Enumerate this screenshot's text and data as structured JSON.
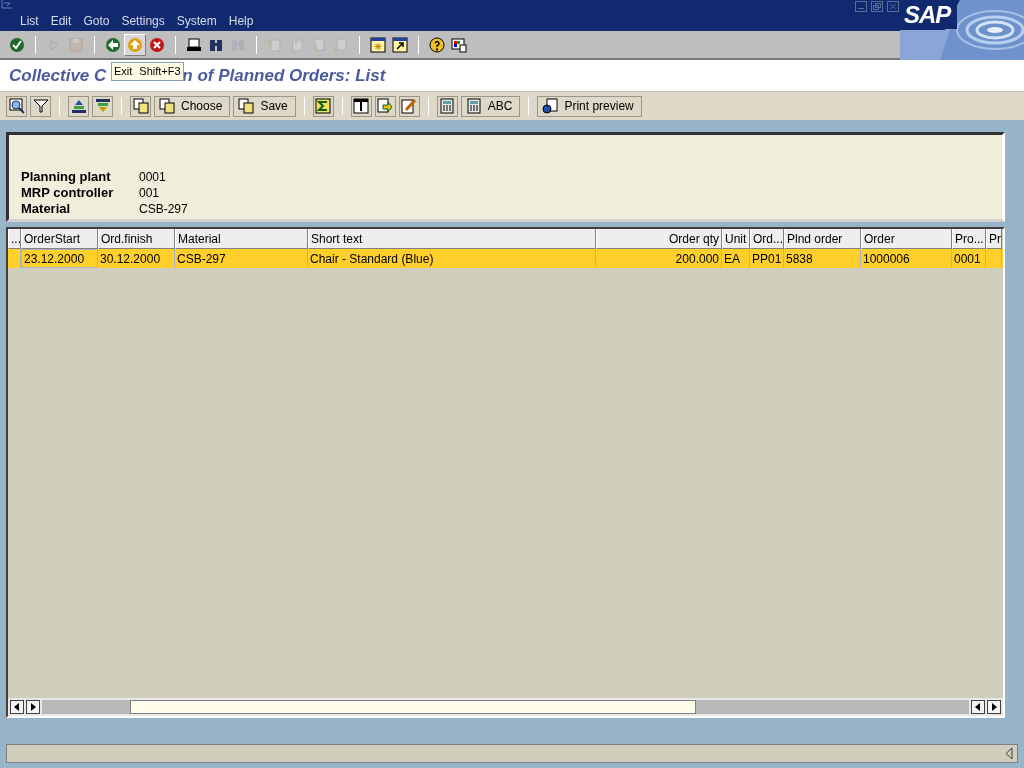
{
  "logo": "SAP",
  "menu": [
    {
      "label": "List"
    },
    {
      "label": "Edit"
    },
    {
      "label": "Goto"
    },
    {
      "label": "Settings"
    },
    {
      "label": "System"
    },
    {
      "label": "Help"
    }
  ],
  "system_toolbar": [
    {
      "kind": "enter",
      "disabled": false
    },
    {
      "kind": "sep"
    },
    {
      "kind": "command",
      "disabled": true
    },
    {
      "kind": "save",
      "disabled": true
    },
    {
      "kind": "sep"
    },
    {
      "kind": "back",
      "disabled": false
    },
    {
      "kind": "exit",
      "disabled": false,
      "hovered": true
    },
    {
      "kind": "cancel",
      "disabled": false
    },
    {
      "kind": "sep"
    },
    {
      "kind": "print",
      "disabled": false
    },
    {
      "kind": "find",
      "disabled": false
    },
    {
      "kind": "findnext",
      "disabled": true
    },
    {
      "kind": "sep"
    },
    {
      "kind": "first",
      "disabled": true
    },
    {
      "kind": "prev",
      "disabled": true
    },
    {
      "kind": "next",
      "disabled": true
    },
    {
      "kind": "last",
      "disabled": true
    },
    {
      "kind": "sep"
    },
    {
      "kind": "session",
      "disabled": false
    },
    {
      "kind": "shortcut",
      "disabled": false
    },
    {
      "kind": "sep"
    },
    {
      "kind": "help",
      "disabled": false
    },
    {
      "kind": "layout",
      "disabled": false
    }
  ],
  "title_visible_parts": [
    "Collective C",
    "n of Planned Orders: List"
  ],
  "tooltip": {
    "label": "Exit",
    "shortcut": "Shift+F3"
  },
  "app_toolbar": [
    {
      "kind": "details"
    },
    {
      "kind": "filter"
    },
    {
      "kind": "sep"
    },
    {
      "kind": "sortup"
    },
    {
      "kind": "sortdown"
    },
    {
      "kind": "sep"
    },
    {
      "kind": "copy"
    },
    {
      "kind": "copy",
      "label": "Choose"
    },
    {
      "kind": "copy",
      "label": "Save"
    },
    {
      "kind": "sep"
    },
    {
      "kind": "sum"
    },
    {
      "kind": "sep"
    },
    {
      "kind": "layoutchange"
    },
    {
      "kind": "export"
    },
    {
      "kind": "edit"
    },
    {
      "kind": "sep"
    },
    {
      "kind": "calc"
    },
    {
      "kind": "calc",
      "label": "ABC"
    },
    {
      "kind": "sep"
    },
    {
      "kind": "preview",
      "label": "Print preview"
    }
  ],
  "header_fields": [
    {
      "label": "Planning plant",
      "value": "0001"
    },
    {
      "label": "MRP controller",
      "value": "001"
    },
    {
      "label": "Material",
      "value": "CSB-297"
    }
  ],
  "table": {
    "columns": [
      {
        "label": "...",
        "kind": "text"
      },
      {
        "label": "OrderStart",
        "kind": "text"
      },
      {
        "label": "Ord.finish",
        "kind": "text"
      },
      {
        "label": "Material",
        "kind": "text"
      },
      {
        "label": "Short text",
        "kind": "text"
      },
      {
        "label": "Order qty",
        "kind": "quantity"
      },
      {
        "label": "Unit",
        "kind": "text"
      },
      {
        "label": "Ord...",
        "kind": "text"
      },
      {
        "label": "Plnd order",
        "kind": "text"
      },
      {
        "label": "Order",
        "kind": "text"
      },
      {
        "label": "Pro...",
        "kind": "text"
      },
      {
        "label": "Pr",
        "kind": "text"
      }
    ],
    "rows": [
      {
        "selected": true,
        "cells": [
          "",
          "23.12.2000",
          "30.12.2000",
          "CSB-297",
          "Chair - Standard (Blue)",
          "200.000",
          "EA",
          "PP01",
          "5838",
          "1000006",
          "0001",
          ""
        ]
      }
    ]
  }
}
